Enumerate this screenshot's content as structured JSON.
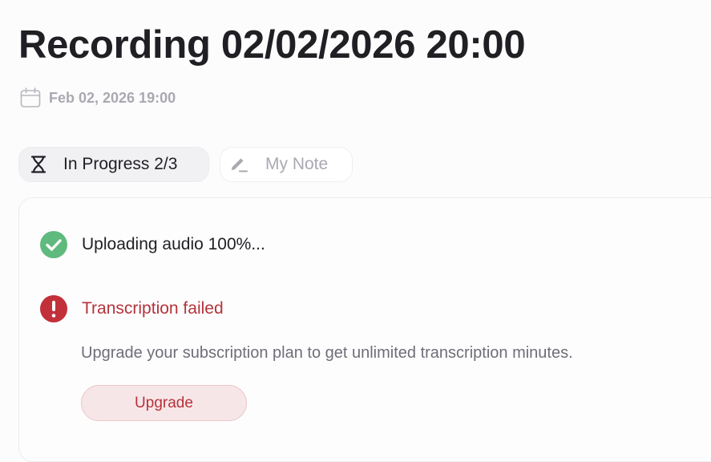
{
  "recording": {
    "title": "Recording 02/02/2026 20:00",
    "date": "Feb 02, 2026 19:00"
  },
  "tabs": [
    {
      "label": "In Progress 2/3",
      "icon": "hourglass-icon",
      "active": true
    },
    {
      "label": "My Note",
      "icon": "pencil-icon",
      "active": false
    }
  ],
  "steps": {
    "upload": {
      "label": "Uploading audio 100%...",
      "icon": "check-circle-icon",
      "status": "done"
    },
    "transcription": {
      "label": "Transcription failed",
      "icon": "error-circle-icon",
      "status": "failed"
    }
  },
  "error": {
    "message": "Upgrade your subscription plan to get unlimited transcription minutes.",
    "button_label": "Upgrade"
  },
  "colors": {
    "success": "#5fba7d",
    "error": "#b5333a",
    "muted": "#a9a9b1",
    "text": "#1f1f24"
  }
}
